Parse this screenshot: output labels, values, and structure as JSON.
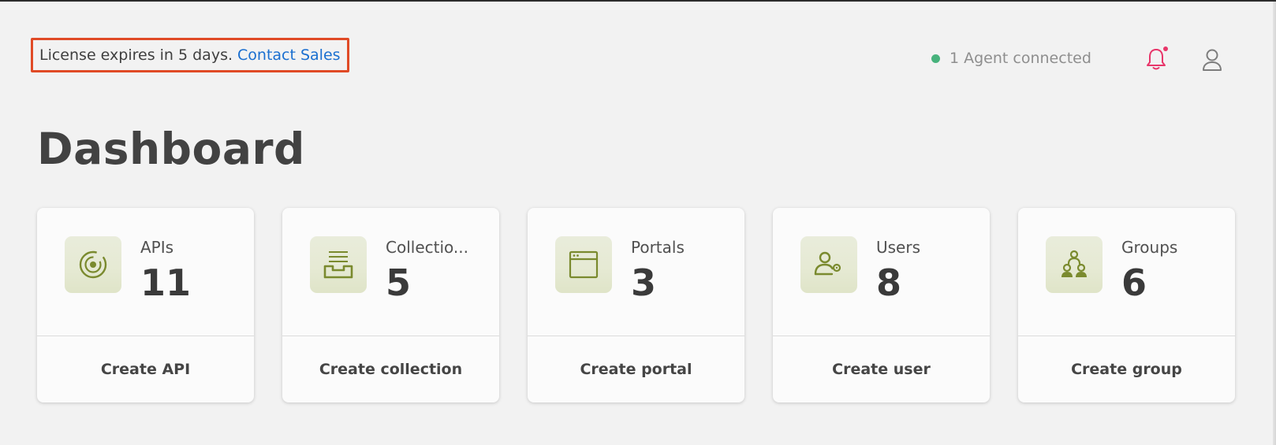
{
  "banner": {
    "text": "License expires in 5 days.",
    "link": "Contact Sales"
  },
  "header": {
    "agent_status": "1 Agent connected",
    "status_color": "#47b27c",
    "notification_icon": "bell-icon",
    "profile_icon": "user-icon"
  },
  "page": {
    "title": "Dashboard"
  },
  "cards": [
    {
      "label": "APIs",
      "count": "11",
      "action": "Create API",
      "icon": "api-icon"
    },
    {
      "label": "Collectio...",
      "count": "5",
      "action": "Create collection",
      "icon": "collection-icon"
    },
    {
      "label": "Portals",
      "count": "3",
      "action": "Create portal",
      "icon": "portal-icon"
    },
    {
      "label": "Users",
      "count": "8",
      "action": "Create user",
      "icon": "users-icon"
    },
    {
      "label": "Groups",
      "count": "6",
      "action": "Create group",
      "icon": "groups-icon"
    }
  ],
  "colors": {
    "accent": "#1a6fd0",
    "icon_green": "#7a8a2e",
    "alert": "#e8366a",
    "banner_border": "#e04a26"
  }
}
